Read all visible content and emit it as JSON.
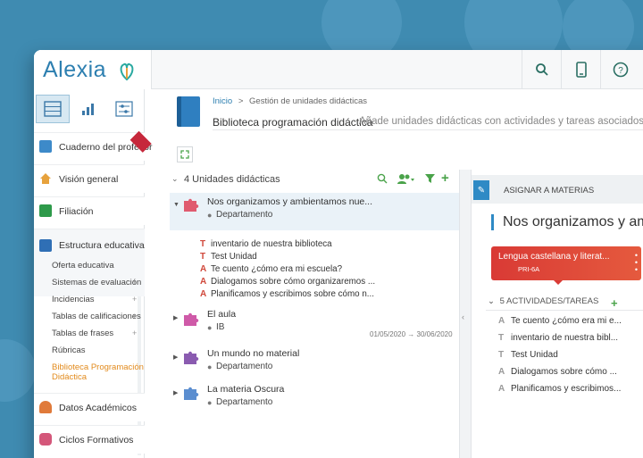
{
  "app": {
    "logo": "Alexia"
  },
  "colors": {
    "accent": "#2d7fb0",
    "brand_red": "#d93a35",
    "green": "#4aa34a",
    "active_menu": "#e28a1c"
  },
  "topbar": {
    "icons": [
      "search-icon",
      "mobile-icon",
      "help-icon"
    ]
  },
  "sidebar": {
    "tabs": [
      "list-icon",
      "chart-icon",
      "sliders-icon"
    ],
    "items": [
      {
        "label": "Cuaderno del profesor"
      },
      {
        "label": "Visión general"
      },
      {
        "label": "Filiación"
      },
      {
        "label": "Estructura educativa"
      },
      {
        "label": "Datos Académicos"
      },
      {
        "label": "Ciclos Formativos"
      }
    ],
    "sub_items": [
      {
        "label": "Oferta educativa"
      },
      {
        "label": "Sistemas de evaluación"
      },
      {
        "label": "Incidencias"
      },
      {
        "label": "Tablas de calificaciones"
      },
      {
        "label": "Tablas de frases"
      },
      {
        "label": "Rúbricas"
      },
      {
        "label": "Biblioteca Programación",
        "label2": "Didáctica"
      }
    ],
    "plus": "+"
  },
  "header": {
    "breadcrumb_home": "Inicio",
    "breadcrumb_sep": ">",
    "breadcrumb_current": "Gestión de unidades didácticas",
    "title": "Biblioteca programación didáctica",
    "subtitle": "Añade unidades didácticas con actividades y tareas asociados"
  },
  "unidades": {
    "count_label": "4 Unidades didácticas",
    "items": [
      {
        "name": "Nos organizamos y ambientamos nue...",
        "dept": "Departamento",
        "tasks": [
          {
            "icon": "T",
            "label": "inventario de nuestra biblioteca"
          },
          {
            "icon": "T",
            "label": "Test Unidad"
          },
          {
            "icon": "A",
            "label": "Te cuento ¿cómo era mi escuela?"
          },
          {
            "icon": "A",
            "label": "Dialogamos sobre cómo organizaremos ..."
          },
          {
            "icon": "A",
            "label": "Planificamos y escribimos sobre cómo n..."
          }
        ]
      },
      {
        "name": "El aula",
        "dept": "IB",
        "date_from": "01/05/2020",
        "date_arrow": "→",
        "date_to": "30/06/2020"
      },
      {
        "name": "Un mundo no material",
        "dept": "Departamento"
      },
      {
        "name": "La materia Oscura",
        "dept": "Departamento"
      }
    ]
  },
  "right": {
    "asignar": "ASIGNAR A MATERIAS",
    "title": "Nos organizamos y amb",
    "materia": "Lengua castellana y literat...",
    "materia_code": "PRI-6A",
    "activities_label": "5 ACTIVIDADES/TAREAS",
    "activities": [
      {
        "icon": "A",
        "label": "Te cuento ¿cómo era mi e..."
      },
      {
        "icon": "T",
        "label": "inventario de nuestra bibl..."
      },
      {
        "icon": "T",
        "label": "Test Unidad"
      },
      {
        "icon": "A",
        "label": "Dialogamos sobre cómo ..."
      },
      {
        "icon": "A",
        "label": "Planificamos y escribimos..."
      }
    ]
  }
}
